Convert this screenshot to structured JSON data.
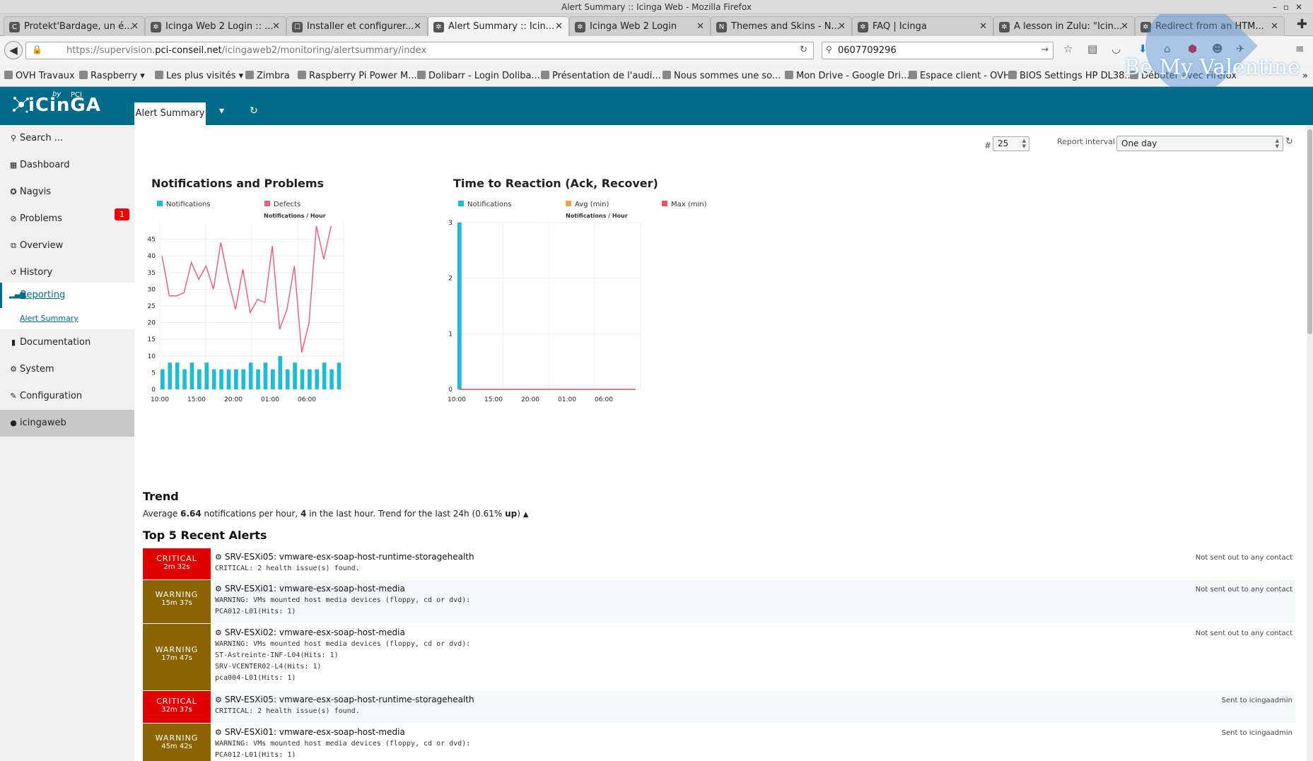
{
  "window": {
    "title": "Alert Summary :: Icinga Web - Mozilla Firefox"
  },
  "tabs": [
    {
      "label": "Protekt'Bardage, un é...",
      "fav": "C"
    },
    {
      "label": "Icinga Web 2 Login :: ...",
      "fav": "✲"
    },
    {
      "label": "Installer et configurer...",
      "fav": "☐"
    },
    {
      "label": "Alert Summary :: Icin...",
      "fav": "✲",
      "active": true
    },
    {
      "label": "Icinga Web 2 Login",
      "fav": "✲"
    },
    {
      "label": "Themes and Skins - N...",
      "fav": "N"
    },
    {
      "label": "FAQ | Icinga",
      "fav": "✲"
    },
    {
      "label": "A lesson in Zulu: \"Icin...",
      "fav": "✲"
    },
    {
      "label": "Redirect from an HTM...",
      "fav": "✲"
    }
  ],
  "nav": {
    "url_prefix": "https://supervision.",
    "url_domain": "pci-conseil.net",
    "url_path": "/icingaweb2/monitoring/alertsummary/index",
    "search_value": "0607709296"
  },
  "bookmarks": [
    "OVH Travaux",
    "Raspberry ▾",
    "Les plus visités ▾",
    "Zimbra",
    "Raspberry Pi Power M...",
    "Dolibarr - Login Doliba...",
    "Présentation de l'audi...",
    "Nous sommes une so...",
    "Mon Drive - Google Dri...",
    "Espace client - OVH",
    "BIOS Settings HP DL38...",
    "Débuter avec Firefox"
  ],
  "valentine": {
    "text": "Be My Valentine"
  },
  "header": {
    "logo_text": "iCinGA",
    "logo_by": "by",
    "logo_pci": "PCI",
    "tab_label": "Alert Summary"
  },
  "sidebar": {
    "search": "Search ...",
    "items": [
      "Dashboard",
      "Nagvis",
      "Problems",
      "Overview",
      "History"
    ],
    "problems_badge": "1",
    "reporting": "Reporting",
    "reporting_sub": "Alert Summary",
    "items2": [
      "Documentation",
      "System",
      "Configuration"
    ],
    "user": "icingaweb"
  },
  "controls": {
    "hash": "#",
    "count": "25",
    "interval_label": "Report interval",
    "interval_value": "One day"
  },
  "panels": {
    "left_title": "Notifications and Problems",
    "right_title": "Time to Reaction (Ack, Recover)",
    "left_legend": [
      "Notifications",
      "Defects"
    ],
    "right_legend": [
      "Notifications",
      "Avg (min)",
      "Max (min)"
    ],
    "subtitle": "Notifications / Hour"
  },
  "colors": {
    "notifications": "#1fbcd2",
    "defects": "#e0677d",
    "avg": "#f0a050",
    "max": "#e0596a",
    "brand": "#006c8a",
    "critical": "#e10000",
    "warning": "#8a6400"
  },
  "chart_data": [
    {
      "type": "bar",
      "title": "Notifications and Problems",
      "subtitle": "Notifications / Hour",
      "x_ticks": [
        "10:00",
        "15:00",
        "20:00",
        "01:00",
        "06:00"
      ],
      "y_ticks": [
        0,
        5,
        10,
        15,
        20,
        25,
        30,
        35,
        40,
        45
      ],
      "ylim": [
        0,
        50
      ],
      "series": [
        {
          "name": "Notifications",
          "type": "bar",
          "values": [
            6,
            8,
            8,
            6,
            8,
            6,
            8,
            6,
            6,
            6,
            6,
            6,
            8,
            6,
            8,
            6,
            10,
            6,
            8,
            6,
            6,
            6,
            8,
            6,
            8
          ]
        },
        {
          "name": "Defects",
          "type": "line",
          "values": [
            40,
            28,
            28,
            29,
            38,
            33,
            37,
            30,
            44,
            33,
            24,
            36,
            23,
            27,
            26,
            43,
            18,
            24,
            37,
            11,
            20,
            49,
            39,
            49
          ]
        }
      ]
    },
    {
      "type": "bar",
      "title": "Time to Reaction (Ack, Recover)",
      "subtitle": "Notifications / Hour",
      "x_ticks": [
        "10:00",
        "15:00",
        "20:00",
        "01:00",
        "06:00"
      ],
      "y_ticks": [
        0,
        1,
        2,
        3
      ],
      "ylim": [
        0,
        3
      ],
      "series": [
        {
          "name": "Notifications",
          "type": "bar",
          "values": [
            3,
            0,
            0,
            0,
            0,
            0,
            0,
            0,
            0,
            0,
            0,
            0,
            0,
            0,
            0,
            0,
            0,
            0,
            0,
            0,
            0,
            0,
            0,
            0,
            0
          ]
        },
        {
          "name": "Avg (min)",
          "type": "line",
          "values": [
            0,
            0,
            0,
            0,
            0,
            0,
            0,
            0,
            0,
            0,
            0,
            0,
            0,
            0,
            0,
            0,
            0,
            0,
            0,
            0,
            0,
            0,
            0,
            0,
            0
          ]
        },
        {
          "name": "Max (min)",
          "type": "line",
          "values": [
            0,
            0,
            0,
            0,
            0,
            0,
            0,
            0,
            0,
            0,
            0,
            0,
            0,
            0,
            0,
            0,
            0,
            0,
            0,
            0,
            0,
            0,
            0,
            0,
            0
          ]
        }
      ]
    }
  ],
  "trend": {
    "title": "Trend",
    "p1": "Average ",
    "avg": "6.64",
    "p2": " notifications per hour, ",
    "last": "4",
    "p3": " in the last hour. Trend for the last 24h (0.61% ",
    "dir": "up",
    "p4": ")"
  },
  "alerts": {
    "title": "Top 5 Recent Alerts",
    "rows": [
      {
        "state": "CRITICAL",
        "time": "2m 32s",
        "name": "SRV-ESXi05: vmware-esx-soap-host-runtime-storagehealth",
        "output": "CRITICAL: 2 health issue(s) found.",
        "contact": "Not sent out to any contact"
      },
      {
        "state": "WARNING",
        "time": "15m 37s",
        "name": "SRV-ESXi01: vmware-esx-soap-host-media",
        "output": "WARNING: VMs mounted host media devices (floppy, cd or dvd):\nPCA012-L01(Hits: 1)",
        "contact": "Not sent out to any contact"
      },
      {
        "state": "WARNING",
        "time": "17m 47s",
        "name": "SRV-ESXi02: vmware-esx-soap-host-media",
        "output": "WARNING: VMs mounted host media devices (floppy, cd or dvd):\nST-Astreinte-INF-L04(Hits: 1)\nSRV-VCENTER02-L4(Hits: 1)\npca004-L01(Hits: 1)",
        "contact": "Not sent out to any contact"
      },
      {
        "state": "CRITICAL",
        "time": "32m 37s",
        "name": "SRV-ESXi05: vmware-esx-soap-host-runtime-storagehealth",
        "output": "CRITICAL: 2 health issue(s) found.",
        "contact": "Sent to icingaadmin"
      },
      {
        "state": "WARNING",
        "time": "45m 42s",
        "name": "SRV-ESXi01: vmware-esx-soap-host-media",
        "output": "WARNING: VMs mounted host media devices (floppy, cd or dvd):\nPCA012-L01(Hits: 1)",
        "contact": "Sent to icingaadmin"
      }
    ]
  }
}
